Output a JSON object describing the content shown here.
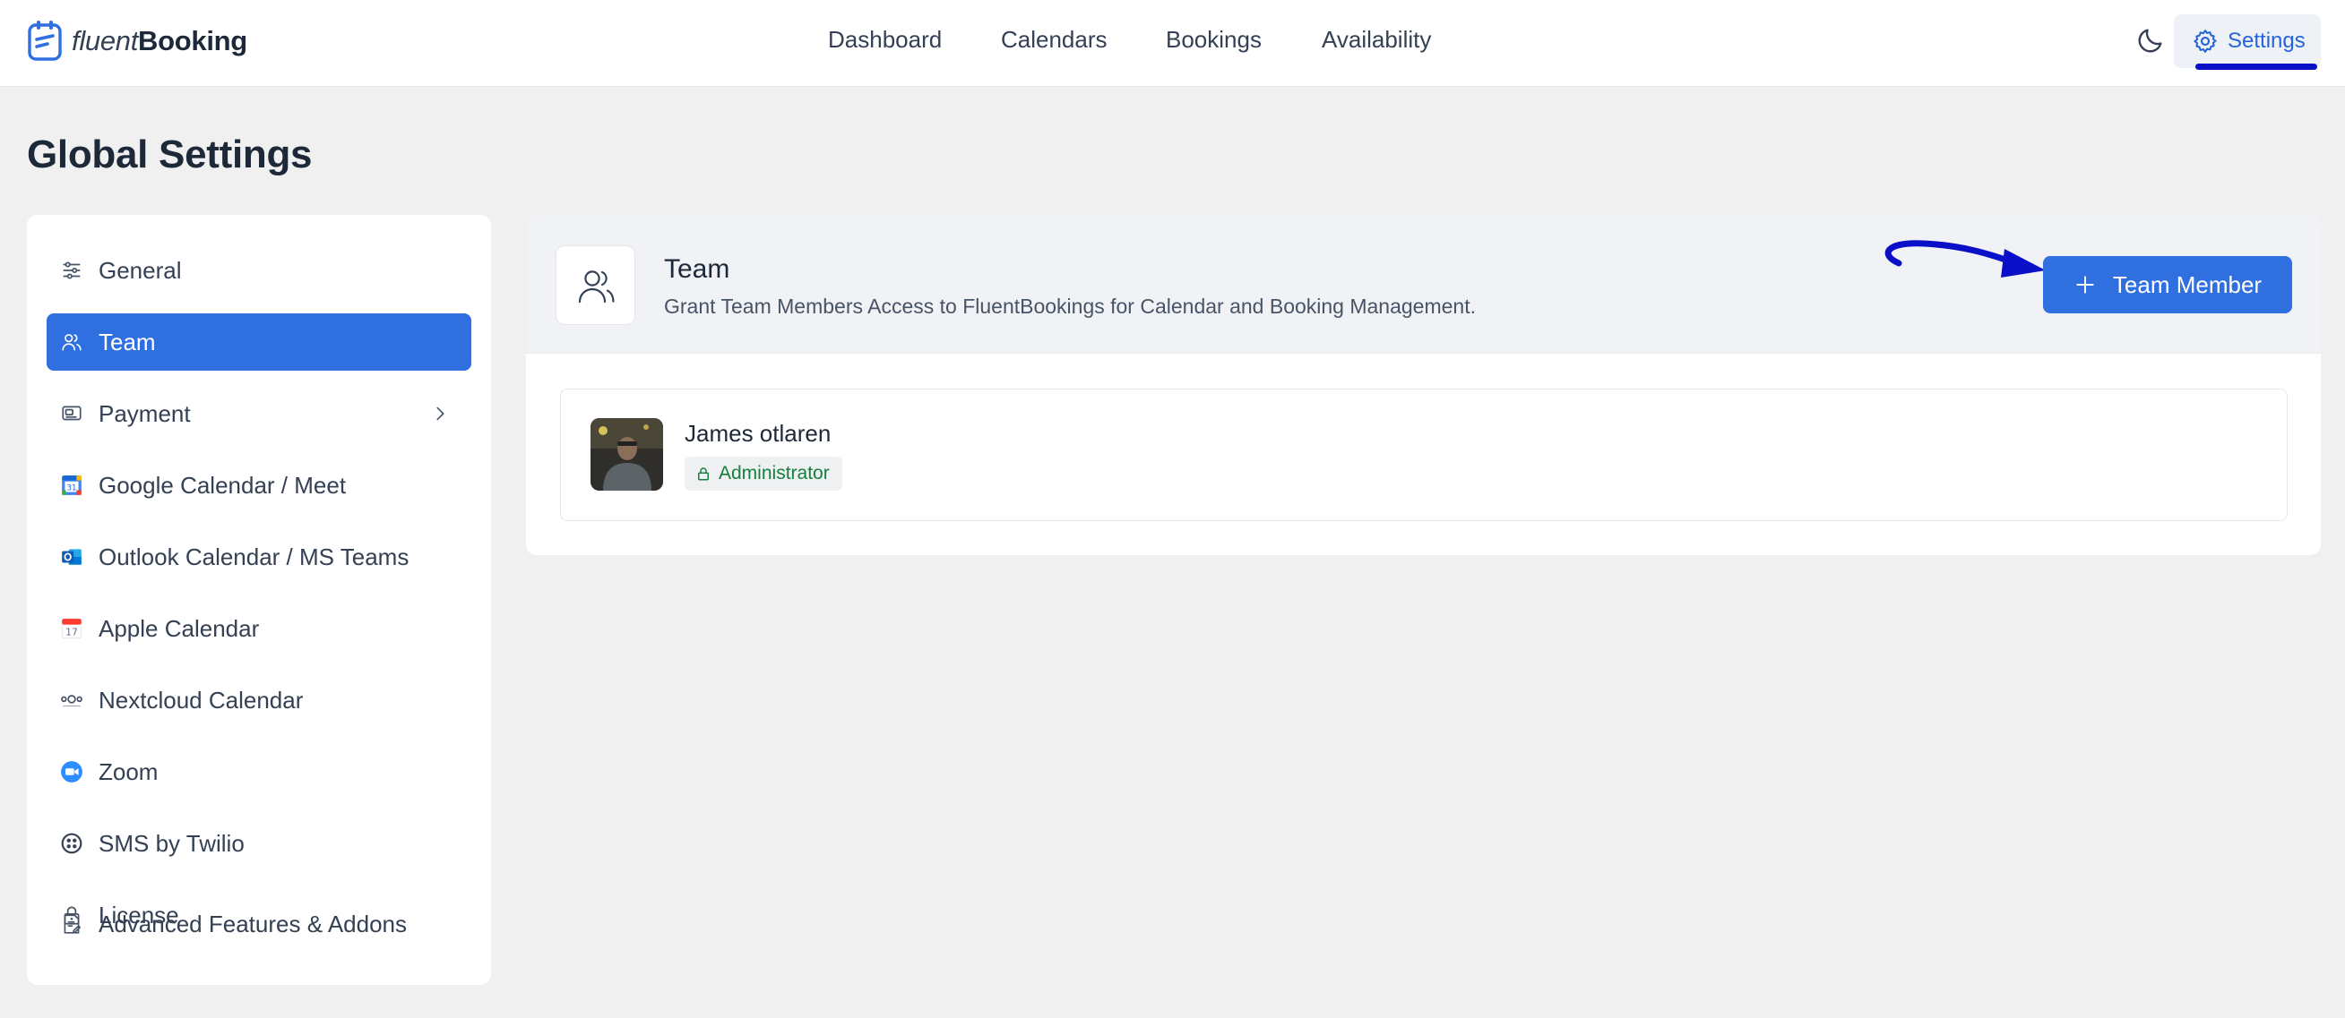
{
  "brand": {
    "name_light": "fluent",
    "name_bold": "Booking",
    "accent_color": "#2f6fe0"
  },
  "nav": {
    "items": [
      {
        "label": "Dashboard"
      },
      {
        "label": "Calendars"
      },
      {
        "label": "Bookings"
      },
      {
        "label": "Availability"
      }
    ],
    "theme_toggle_icon": "moon-icon",
    "settings_label": "Settings"
  },
  "page": {
    "title": "Global Settings"
  },
  "sidebar": {
    "items": [
      {
        "label": "General",
        "icon": "sliders-icon"
      },
      {
        "label": "Team",
        "icon": "users-icon",
        "active": true
      },
      {
        "label": "Payment",
        "icon": "payment-icon",
        "has_submenu": true
      },
      {
        "label": "Google Calendar / Meet",
        "icon": "google-calendar-icon"
      },
      {
        "label": "Outlook Calendar / MS Teams",
        "icon": "outlook-icon"
      },
      {
        "label": "Apple Calendar",
        "icon": "apple-calendar-icon"
      },
      {
        "label": "Nextcloud Calendar",
        "icon": "nextcloud-icon"
      },
      {
        "label": "Zoom",
        "icon": "zoom-icon"
      },
      {
        "label": "SMS by Twilio",
        "icon": "twilio-icon"
      },
      {
        "label": "License",
        "icon": "lock-icon"
      },
      {
        "label": "Advanced Features & Addons",
        "icon": "addons-icon"
      }
    ]
  },
  "team": {
    "title": "Team",
    "description": "Grant Team Members Access to FluentBookings for Calendar and Booking Management.",
    "add_button_label": "Team Member",
    "members": [
      {
        "name": "James otlaren",
        "role": "Administrator"
      }
    ]
  }
}
